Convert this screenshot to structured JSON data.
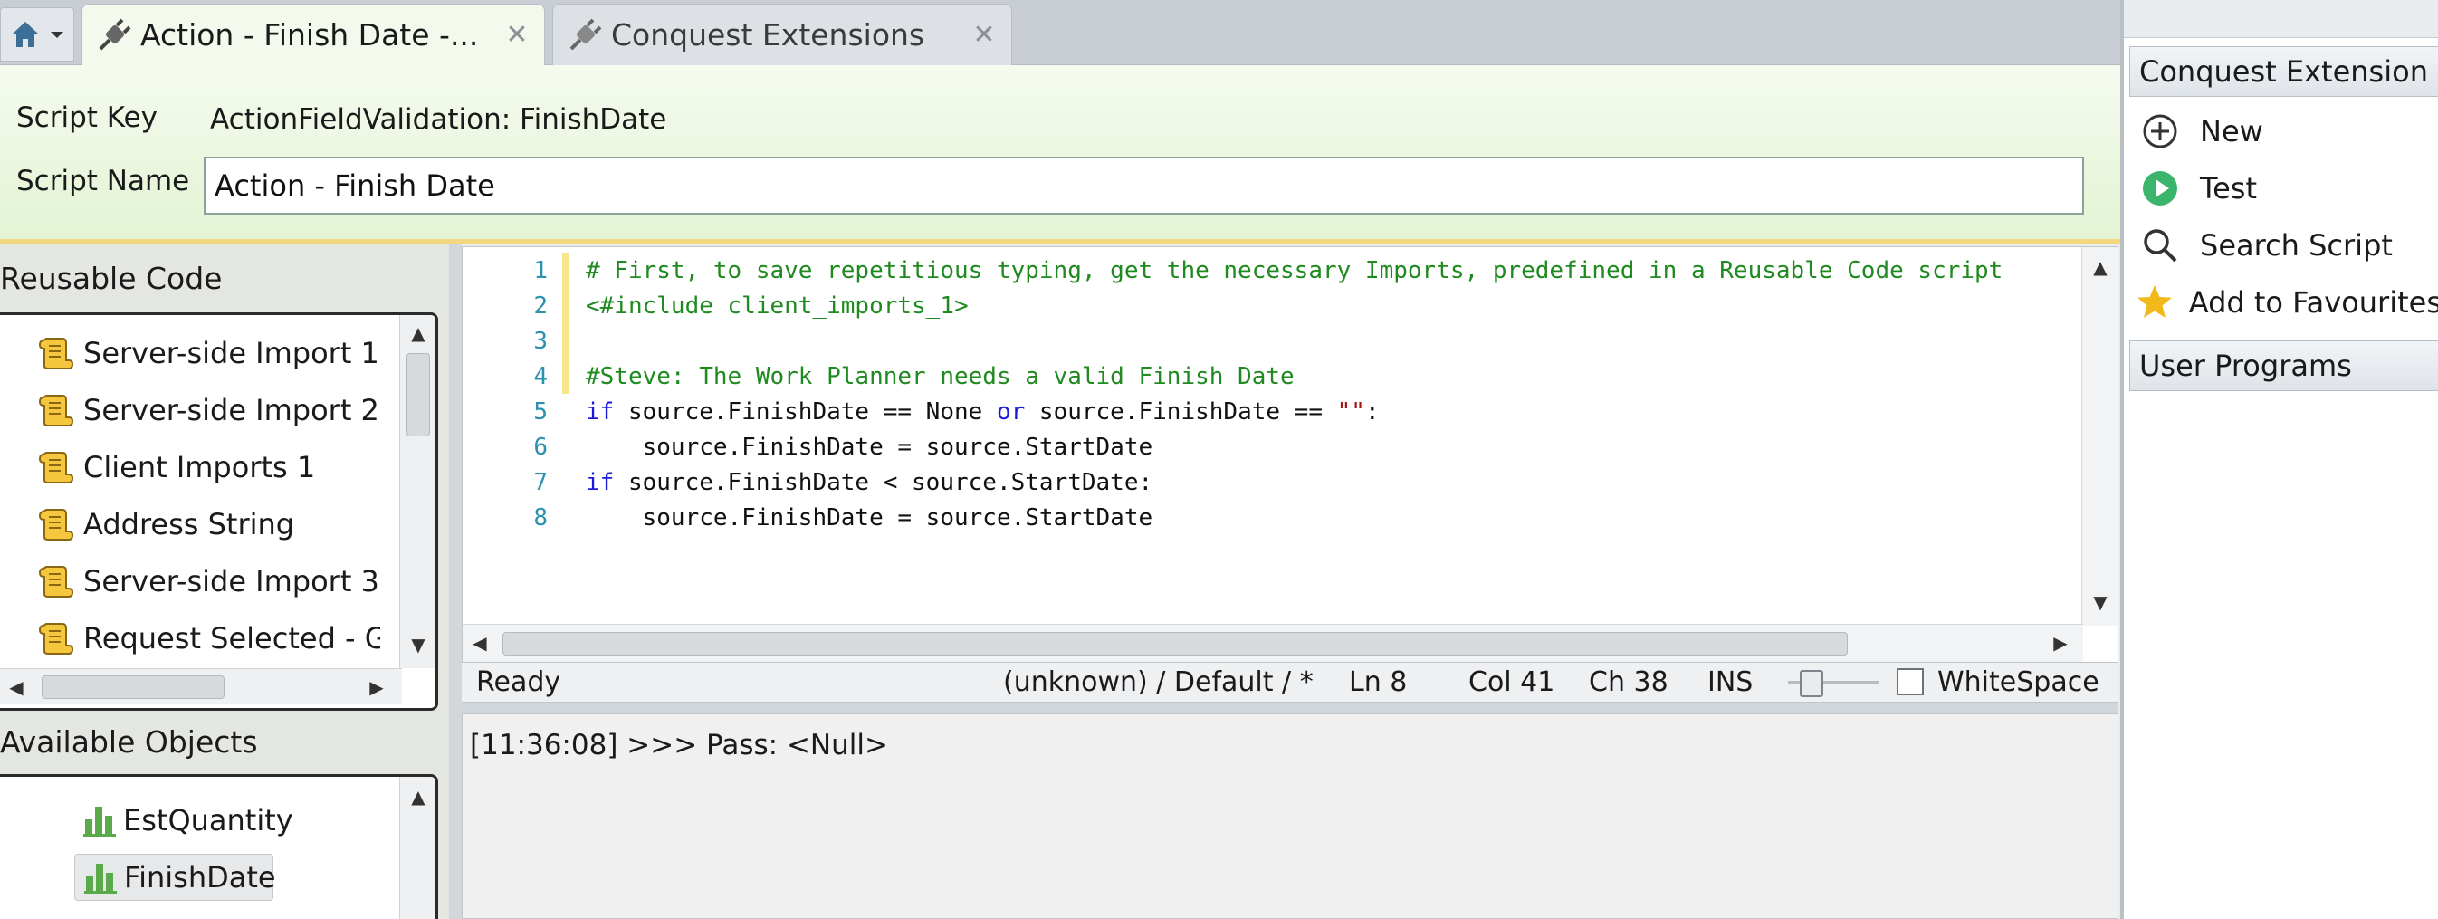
{
  "tabs": [
    {
      "title": "Action - Finish Date -...",
      "close": "✕"
    },
    {
      "title": "Conquest Extensions",
      "close": "✕"
    }
  ],
  "header": {
    "script_key_label": "Script Key",
    "script_key_value": "ActionFieldValidation: FinishDate",
    "script_name_label": "Script Name",
    "script_name_value": "Action - Finish Date"
  },
  "reusable_code": {
    "title": "Reusable Code",
    "items": [
      "Server-side Import 1",
      "Server-side Import 2",
      "Client Imports 1",
      "Address String",
      "Server-side Import 3",
      "Request Selected - Get"
    ]
  },
  "available_objects": {
    "title": "Available Objects",
    "items": [
      "EstQuantity",
      "FinishDate"
    ],
    "selected": "FinishDate"
  },
  "editor": {
    "lines": [
      {
        "num": "1",
        "changed": true,
        "tokens": [
          {
            "t": "# First, to save repetitious typing, get the necessary Imports, predefined in a Reusable Code script",
            "c": "comment"
          }
        ]
      },
      {
        "num": "2",
        "changed": true,
        "tokens": [
          {
            "t": "<#include client_imports_1>",
            "c": "comment"
          }
        ]
      },
      {
        "num": "3",
        "changed": true,
        "tokens": []
      },
      {
        "num": "4",
        "changed": true,
        "tokens": [
          {
            "t": "#Steve: The Work Planner needs a valid Finish Date",
            "c": "comment"
          }
        ]
      },
      {
        "num": "5",
        "changed": false,
        "tokens": [
          {
            "t": "if",
            "c": "kw"
          },
          {
            "t": " source.FinishDate == None ",
            "c": "txt"
          },
          {
            "t": "or",
            "c": "kw"
          },
          {
            "t": " source.FinishDate == ",
            "c": "txt"
          },
          {
            "t": "\"\"",
            "c": "str"
          },
          {
            "t": ":",
            "c": "txt"
          }
        ]
      },
      {
        "num": "6",
        "changed": false,
        "tokens": [
          {
            "t": "    source.FinishDate = source.StartDate",
            "c": "txt"
          }
        ]
      },
      {
        "num": "7",
        "changed": false,
        "tokens": [
          {
            "t": "if",
            "c": "kw"
          },
          {
            "t": " source.FinishDate < source.StartDate:",
            "c": "txt"
          }
        ]
      },
      {
        "num": "8",
        "changed": false,
        "tokens": [
          {
            "t": "    source.FinishDate = source.StartDate",
            "c": "txt"
          }
        ]
      }
    ],
    "colors": {
      "comment": "#1f8a1f",
      "keyword": "#1a1ad8",
      "line_number": "#2b91af",
      "change_marker": "#f5e88a"
    }
  },
  "status": {
    "ready": "Ready",
    "context": "(unknown) / Default / *",
    "ln": "Ln 8",
    "col": "Col 41",
    "ch": "Ch 38",
    "mode": "INS",
    "whitespace_label": "WhiteSpace",
    "whitespace_checked": false
  },
  "output": {
    "text": "[11:36:08] >>> Pass: <Null>"
  },
  "right_panel": {
    "header": "Conquest Extension",
    "items": [
      {
        "label": "New",
        "icon": "plus-circle-icon"
      },
      {
        "label": "Test",
        "icon": "play-icon"
      },
      {
        "label": "Search Script",
        "icon": "magnifier-icon"
      },
      {
        "label": "Add to Favourites",
        "icon": "star-icon"
      }
    ],
    "section2": "User Programs"
  }
}
